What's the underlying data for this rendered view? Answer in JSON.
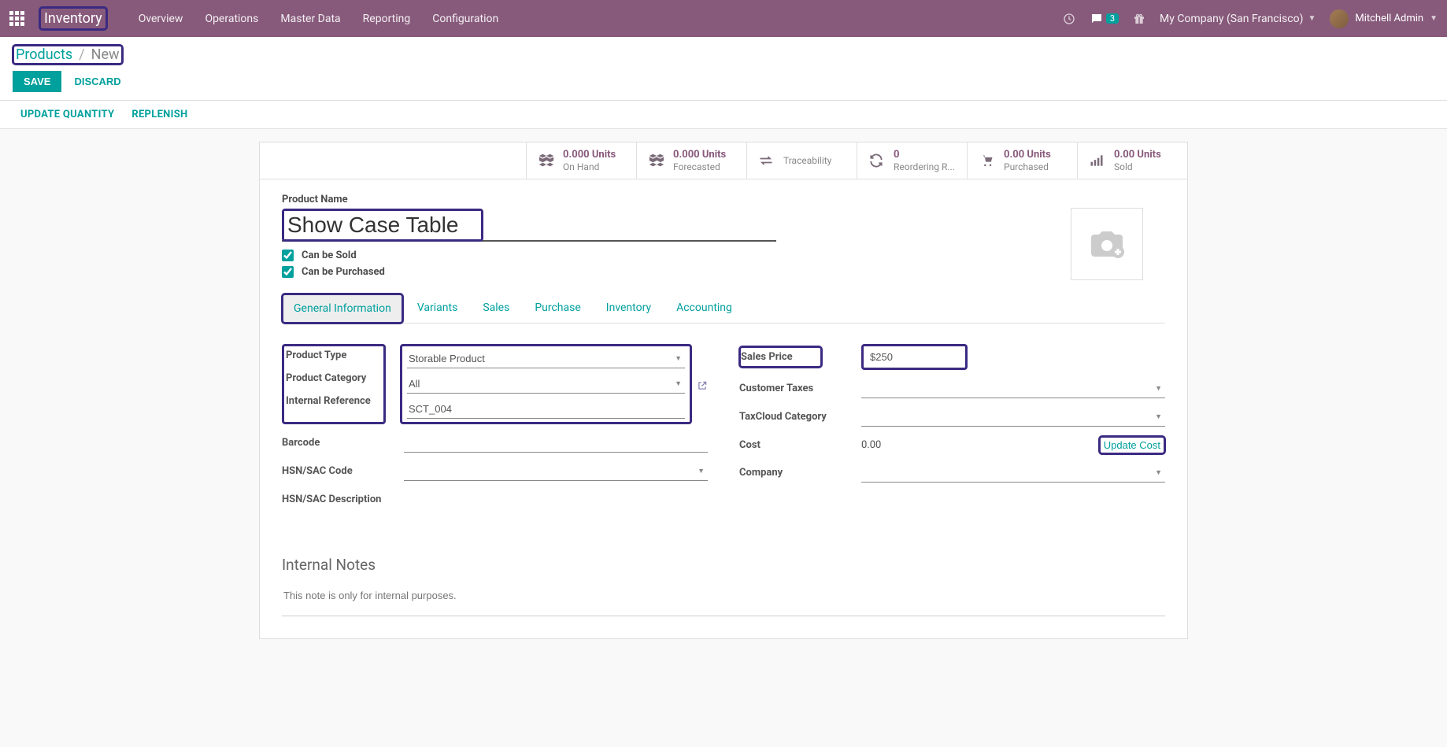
{
  "topbar": {
    "brand": "Inventory",
    "nav": [
      "Overview",
      "Operations",
      "Master Data",
      "Reporting",
      "Configuration"
    ],
    "messages_badge": "3",
    "company": "My Company (San Francisco)",
    "user": "Mitchell Admin"
  },
  "breadcrumb": {
    "link": "Products",
    "current": "New"
  },
  "actions": {
    "save": "SAVE",
    "discard": "DISCARD"
  },
  "subactions": {
    "update_qty": "UPDATE QUANTITY",
    "replenish": "REPLENISH"
  },
  "stats": [
    {
      "value": "0.000 Units",
      "label": "On Hand"
    },
    {
      "value": "0.000 Units",
      "label": "Forecasted"
    },
    {
      "value": "",
      "label": "Traceability"
    },
    {
      "value": "0",
      "label": "Reordering R..."
    },
    {
      "value": "0.00 Units",
      "label": "Purchased"
    },
    {
      "value": "0.00 Units",
      "label": "Sold"
    }
  ],
  "form": {
    "product_name_label": "Product Name",
    "product_name": "Show Case Table",
    "can_sold": "Can be Sold",
    "can_purchased": "Can be Purchased"
  },
  "tabs": [
    "General Information",
    "Variants",
    "Sales",
    "Purchase",
    "Inventory",
    "Accounting"
  ],
  "left_fields": {
    "product_type_label": "Product Type",
    "product_type": "Storable Product",
    "product_category_label": "Product Category",
    "product_category": "All",
    "internal_ref_label": "Internal Reference",
    "internal_ref": "SCT_004",
    "barcode_label": "Barcode",
    "barcode": "",
    "hsn_code_label": "HSN/SAC Code",
    "hsn_code": "",
    "hsn_desc_label": "HSN/SAC Description",
    "hsn_desc": ""
  },
  "right_fields": {
    "sales_price_label": "Sales Price",
    "sales_price": "$250",
    "customer_taxes_label": "Customer Taxes",
    "customer_taxes": "",
    "taxcloud_label": "TaxCloud Category",
    "taxcloud": "",
    "cost_label": "Cost",
    "cost_value": "0.00",
    "update_cost": "Update Cost",
    "company_label": "Company",
    "company": ""
  },
  "notes": {
    "title": "Internal Notes",
    "placeholder": "This note is only for internal purposes."
  }
}
